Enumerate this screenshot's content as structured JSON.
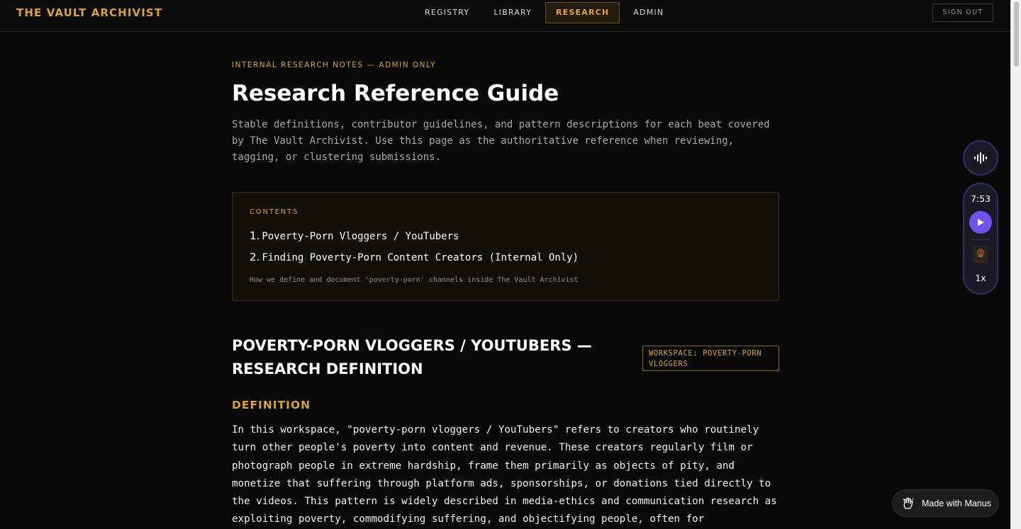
{
  "brand": "THE VAULT ARCHIVIST",
  "nav": {
    "items": [
      "REGISTRY",
      "LIBRARY",
      "RESEARCH",
      "ADMIN"
    ],
    "active": "RESEARCH",
    "sign_out": "SIGN OUT"
  },
  "page": {
    "eyebrow": "INTERNAL RESEARCH NOTES — ADMIN ONLY",
    "title": "Research Reference Guide",
    "lead": "Stable definitions, contributor guidelines, and pattern descriptions for each beat covered by The Vault Archivist. Use this page as the authoritative reference when reviewing, tagging, or clustering submissions."
  },
  "toc": {
    "label": "CONTENTS",
    "items": [
      {
        "num": "1.",
        "label": "Poverty-Porn Vloggers / YouTubers"
      },
      {
        "num": "2.",
        "label": "Finding Poverty-Porn Content Creators (Internal Only)"
      }
    ],
    "note": "How we define and document 'poverty-porn' channels inside The Vault Archivist"
  },
  "section": {
    "title": "POVERTY-PORN VLOGGERS / YOUTUBERS — RESEARCH DEFINITION",
    "badge": "WORKSPACE: POVERTY-PORN VLOGGERS",
    "subheading": "DEFINITION",
    "body": "In this workspace, \"poverty-porn vloggers / YouTubers\" refers to creators who routinely turn other people's poverty into content and revenue. These creators regularly film or photograph people in extreme hardship, frame them primarily as objects of pity, and monetize that suffering through platform ads, sponsorships, or donations tied directly to the videos. This pattern is widely described in media-ethics and communication research as exploiting poverty, commodifying suffering, and objectifying people, often for"
  },
  "player": {
    "time": "7:53",
    "speed": "1x"
  },
  "made_with": "Made with Manus",
  "colors": {
    "accent": "#d9a23e",
    "background": "#080808",
    "play_button": "#6f52f0"
  },
  "icons": [
    "audio-wave-icon",
    "play-icon",
    "avatar",
    "manus-hand-icon"
  ]
}
